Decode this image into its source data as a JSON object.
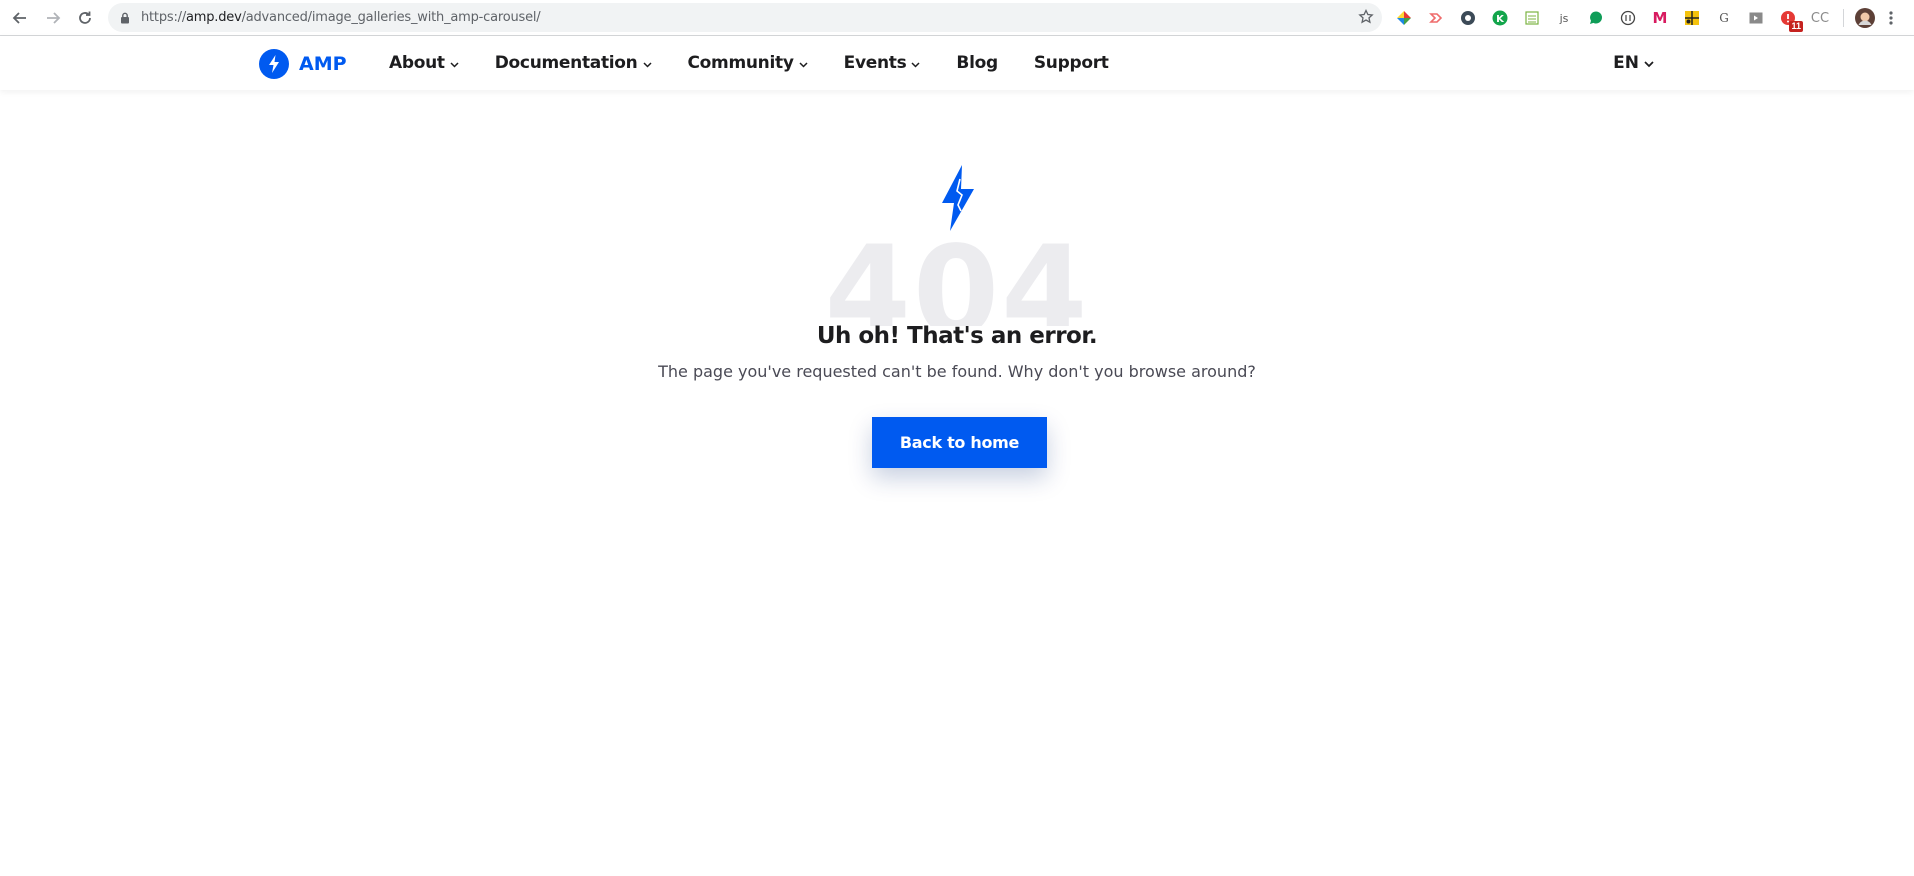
{
  "browser": {
    "url_scheme": "https://",
    "url_host": "amp.dev",
    "url_path": "/advanced/image_galleries_with_amp-carousel/",
    "extensions": [
      {
        "name": "colorful-pinwheel-icon"
      },
      {
        "name": "arrow-extension-icon"
      },
      {
        "name": "github-extension-icon"
      },
      {
        "name": "k-extension-icon"
      },
      {
        "name": "sheet-extension-icon"
      },
      {
        "name": "js-extension-icon"
      },
      {
        "name": "chat-bubble-icon"
      },
      {
        "name": "circle-extension-icon"
      },
      {
        "name": "m-extension-icon"
      },
      {
        "name": "grid-extension-icon"
      },
      {
        "name": "g-extension-icon"
      },
      {
        "name": "media-extension-icon"
      },
      {
        "name": "alert-extension-icon",
        "badge": "11"
      },
      {
        "name": "cc-extension-icon"
      }
    ],
    "ext_labels": {
      "js": "js",
      "g": "G",
      "cc": "CC",
      "m": "M",
      "k": "K"
    }
  },
  "header": {
    "logo_text": "AMP",
    "nav": [
      {
        "label": "About",
        "has_dropdown": true
      },
      {
        "label": "Documentation",
        "has_dropdown": true
      },
      {
        "label": "Community",
        "has_dropdown": true
      },
      {
        "label": "Events",
        "has_dropdown": true
      },
      {
        "label": "Blog",
        "has_dropdown": false
      },
      {
        "label": "Support",
        "has_dropdown": false
      }
    ],
    "language": "EN"
  },
  "error": {
    "code": "404",
    "title": "Uh oh! That's an error.",
    "message": "The page you've requested can't be found. Why don't you browse around?",
    "button_label": "Back to home"
  },
  "colors": {
    "brand": "#005af0",
    "text": "#1d1d1f",
    "muted_code": "#ececef"
  }
}
